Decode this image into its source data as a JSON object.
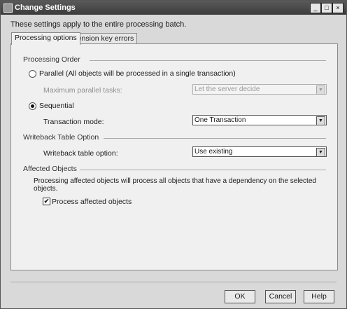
{
  "window": {
    "title": "Change Settings",
    "minimize_glyph": "_",
    "maximize_glyph": "□",
    "close_glyph": "×"
  },
  "intro_text": "These settings apply to the entire processing batch.",
  "tabs": [
    {
      "label": "Processing options",
      "active": true
    },
    {
      "label": "Dimension key errors",
      "active": false
    }
  ],
  "processing_order": {
    "heading": "Processing Order",
    "parallel_label": "Parallel (All objects will be processed in a single transaction)",
    "parallel_selected": false,
    "max_parallel_label": "Maximum parallel tasks:",
    "max_parallel_value": "Let the server decide",
    "sequential_label": "Sequential",
    "sequential_selected": true,
    "transaction_mode_label": "Transaction mode:",
    "transaction_mode_value": "One Transaction"
  },
  "writeback": {
    "heading": "Writeback Table Option",
    "option_label": "Writeback table option:",
    "option_value": "Use existing"
  },
  "affected": {
    "heading": "Affected Objects",
    "description": "Processing affected objects will process all objects that have a dependency on the selected objects.",
    "checkbox_label": "Process affected objects",
    "checked": true,
    "check_glyph": "✔"
  },
  "buttons": {
    "ok": "OK",
    "cancel": "Cancel",
    "help": "Help"
  },
  "dropdown_arrow_glyph": "▼"
}
